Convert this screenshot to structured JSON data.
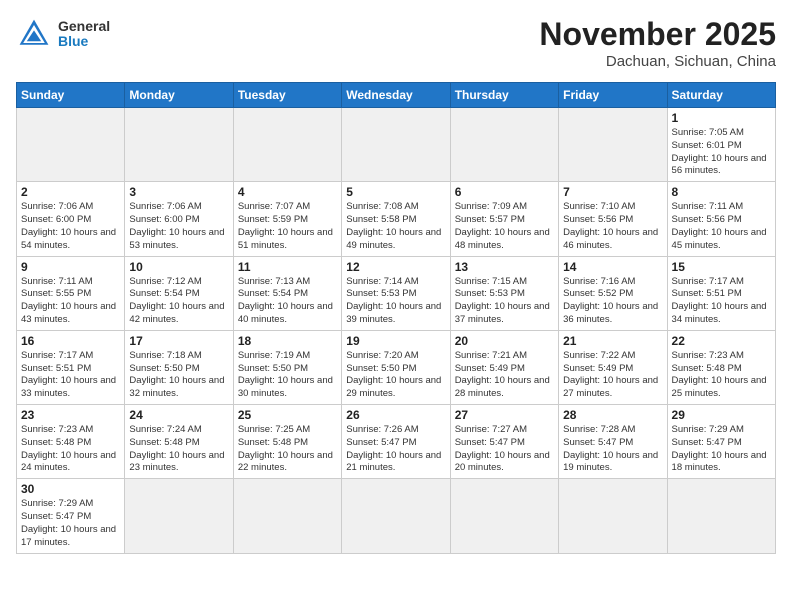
{
  "header": {
    "logo_general": "General",
    "logo_blue": "Blue",
    "month_title": "November 2025",
    "location": "Dachuan, Sichuan, China"
  },
  "weekdays": [
    "Sunday",
    "Monday",
    "Tuesday",
    "Wednesday",
    "Thursday",
    "Friday",
    "Saturday"
  ],
  "days": [
    {
      "date": null
    },
    {
      "date": null
    },
    {
      "date": null
    },
    {
      "date": null
    },
    {
      "date": null
    },
    {
      "date": null
    },
    {
      "date": "1",
      "sunrise": "7:05 AM",
      "sunset": "6:01 PM",
      "daylight": "10 hours and 56 minutes."
    },
    {
      "date": "2",
      "sunrise": "7:06 AM",
      "sunset": "6:00 PM",
      "daylight": "10 hours and 54 minutes."
    },
    {
      "date": "3",
      "sunrise": "7:06 AM",
      "sunset": "6:00 PM",
      "daylight": "10 hours and 53 minutes."
    },
    {
      "date": "4",
      "sunrise": "7:07 AM",
      "sunset": "5:59 PM",
      "daylight": "10 hours and 51 minutes."
    },
    {
      "date": "5",
      "sunrise": "7:08 AM",
      "sunset": "5:58 PM",
      "daylight": "10 hours and 49 minutes."
    },
    {
      "date": "6",
      "sunrise": "7:09 AM",
      "sunset": "5:57 PM",
      "daylight": "10 hours and 48 minutes."
    },
    {
      "date": "7",
      "sunrise": "7:10 AM",
      "sunset": "5:56 PM",
      "daylight": "10 hours and 46 minutes."
    },
    {
      "date": "8",
      "sunrise": "7:11 AM",
      "sunset": "5:56 PM",
      "daylight": "10 hours and 45 minutes."
    },
    {
      "date": "9",
      "sunrise": "7:11 AM",
      "sunset": "5:55 PM",
      "daylight": "10 hours and 43 minutes."
    },
    {
      "date": "10",
      "sunrise": "7:12 AM",
      "sunset": "5:54 PM",
      "daylight": "10 hours and 42 minutes."
    },
    {
      "date": "11",
      "sunrise": "7:13 AM",
      "sunset": "5:54 PM",
      "daylight": "10 hours and 40 minutes."
    },
    {
      "date": "12",
      "sunrise": "7:14 AM",
      "sunset": "5:53 PM",
      "daylight": "10 hours and 39 minutes."
    },
    {
      "date": "13",
      "sunrise": "7:15 AM",
      "sunset": "5:53 PM",
      "daylight": "10 hours and 37 minutes."
    },
    {
      "date": "14",
      "sunrise": "7:16 AM",
      "sunset": "5:52 PM",
      "daylight": "10 hours and 36 minutes."
    },
    {
      "date": "15",
      "sunrise": "7:17 AM",
      "sunset": "5:51 PM",
      "daylight": "10 hours and 34 minutes."
    },
    {
      "date": "16",
      "sunrise": "7:17 AM",
      "sunset": "5:51 PM",
      "daylight": "10 hours and 33 minutes."
    },
    {
      "date": "17",
      "sunrise": "7:18 AM",
      "sunset": "5:50 PM",
      "daylight": "10 hours and 32 minutes."
    },
    {
      "date": "18",
      "sunrise": "7:19 AM",
      "sunset": "5:50 PM",
      "daylight": "10 hours and 30 minutes."
    },
    {
      "date": "19",
      "sunrise": "7:20 AM",
      "sunset": "5:50 PM",
      "daylight": "10 hours and 29 minutes."
    },
    {
      "date": "20",
      "sunrise": "7:21 AM",
      "sunset": "5:49 PM",
      "daylight": "10 hours and 28 minutes."
    },
    {
      "date": "21",
      "sunrise": "7:22 AM",
      "sunset": "5:49 PM",
      "daylight": "10 hours and 27 minutes."
    },
    {
      "date": "22",
      "sunrise": "7:23 AM",
      "sunset": "5:48 PM",
      "daylight": "10 hours and 25 minutes."
    },
    {
      "date": "23",
      "sunrise": "7:23 AM",
      "sunset": "5:48 PM",
      "daylight": "10 hours and 24 minutes."
    },
    {
      "date": "24",
      "sunrise": "7:24 AM",
      "sunset": "5:48 PM",
      "daylight": "10 hours and 23 minutes."
    },
    {
      "date": "25",
      "sunrise": "7:25 AM",
      "sunset": "5:48 PM",
      "daylight": "10 hours and 22 minutes."
    },
    {
      "date": "26",
      "sunrise": "7:26 AM",
      "sunset": "5:47 PM",
      "daylight": "10 hours and 21 minutes."
    },
    {
      "date": "27",
      "sunrise": "7:27 AM",
      "sunset": "5:47 PM",
      "daylight": "10 hours and 20 minutes."
    },
    {
      "date": "28",
      "sunrise": "7:28 AM",
      "sunset": "5:47 PM",
      "daylight": "10 hours and 19 minutes."
    },
    {
      "date": "29",
      "sunrise": "7:29 AM",
      "sunset": "5:47 PM",
      "daylight": "10 hours and 18 minutes."
    },
    {
      "date": "30",
      "sunrise": "7:29 AM",
      "sunset": "5:47 PM",
      "daylight": "10 hours and 17 minutes."
    },
    {
      "date": null
    },
    {
      "date": null
    },
    {
      "date": null
    },
    {
      "date": null
    },
    {
      "date": null
    },
    {
      "date": null
    }
  ]
}
